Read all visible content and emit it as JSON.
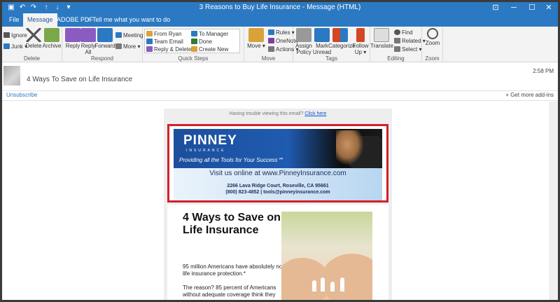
{
  "window": {
    "title": "3 Reasons to Buy Life Insurance  -  Message (HTML)",
    "colors": {
      "accent": "#2b79c2",
      "highlight": "#d0222a"
    }
  },
  "quick_access": [
    "save-icon",
    "undo-icon",
    "redo-icon",
    "up-icon",
    "down-icon",
    "more-icon"
  ],
  "tabs": [
    "File",
    "Message",
    "ADOBE PDF",
    "Tell me what you want to do"
  ],
  "ribbon": {
    "delete": {
      "ignore": "Ignore",
      "junk": "Junk",
      "delete": "Delete",
      "archive": "Archive",
      "label": "Delete"
    },
    "respond": {
      "reply": "Reply",
      "reply_all_1": "Reply",
      "reply_all_2": "All",
      "forward": "Forward",
      "meeting": "Meeting",
      "more": "More",
      "label": "Respond"
    },
    "quick_steps": {
      "items": [
        "From Ryan",
        "To Manager",
        "Team Email",
        "Done",
        "Reply & Delete",
        "Create New"
      ],
      "label": "Quick Steps"
    },
    "move": {
      "move": "Move",
      "rules": "Rules",
      "onenote": "OneNote",
      "actions": "Actions",
      "label": "Move"
    },
    "tags": {
      "assign_1": "Assign",
      "assign_2": "Policy",
      "mark_1": "Mark",
      "mark_2": "Unread",
      "categorize": "Categorize",
      "follow_1": "Follow",
      "follow_2": "Up",
      "label": "Tags"
    },
    "editing": {
      "translate": "Translate",
      "find": "Find",
      "related": "Related",
      "select": "Select",
      "label": "Editing"
    },
    "zoom": {
      "zoom": "Zoom",
      "label": "Zoom"
    }
  },
  "message": {
    "subject": "4 Ways To Save on Life Insurance",
    "time": "2:58 PM",
    "unsubscribe": "Unsubscribe",
    "addins": "Get more add-ins"
  },
  "email": {
    "trouble_text": "Having trouble viewing this email?",
    "trouble_link": "Click here",
    "logo": "PINNEY",
    "logo_sub": "INSURANCE",
    "tagline": "Providing all the Tools for Your Success℠",
    "visit": "Visit us online at www.PinneyInsurance.com",
    "address": "2266 Lava Ridge Court, Roseville, CA 95661",
    "contact": "(800) 823-4852 | tools@pinneyinsurance.com",
    "headline": "4 Ways to Save on Life Insurance",
    "para1": "95 million Americans have absolutely no life insurance protection.*",
    "para2": "The reason? 85 percent of Americans without adequate coverage think they"
  }
}
